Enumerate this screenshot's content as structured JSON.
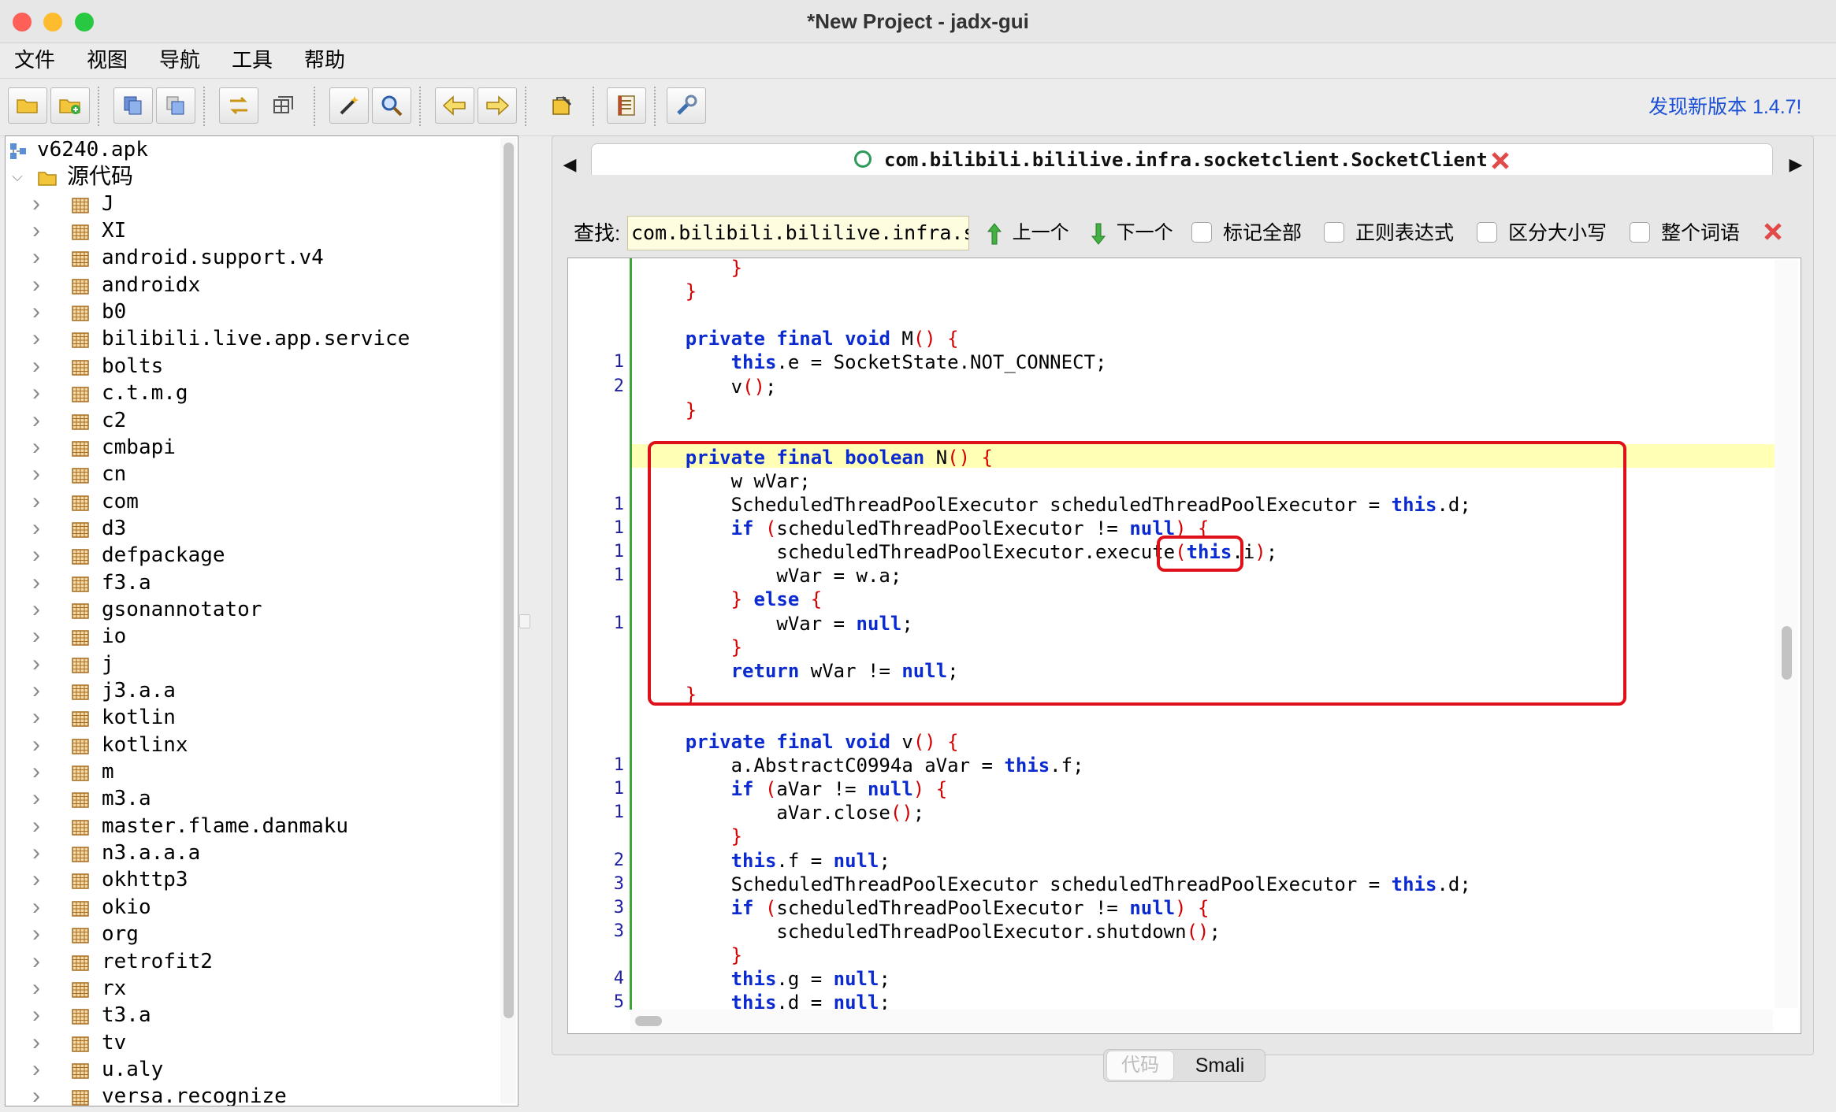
{
  "window": {
    "title": "*New Project - jadx-gui",
    "colors": {
      "close": "#fe5f57",
      "minimize": "#febc2e",
      "zoom": "#28c840"
    }
  },
  "menu": [
    "文件",
    "视图",
    "导航",
    "工具",
    "帮助"
  ],
  "toolbar": {
    "update_link": "发现新版本 1.4.7!",
    "buttons": [
      {
        "name": "open-file-button",
        "icon": "folder-open-icon"
      },
      {
        "name": "add-files-button",
        "icon": "folder-add-icon"
      },
      {
        "name": "save-all-button",
        "icon": "save-all-icon"
      },
      {
        "name": "export-button",
        "icon": "export-icon"
      },
      {
        "name": "sync-tree-button",
        "icon": "sync-icon"
      },
      {
        "name": "flatten-packages-button",
        "icon": "package-icon"
      },
      {
        "name": "decompile-all-button",
        "icon": "magic-wand-icon"
      },
      {
        "name": "search-button",
        "icon": "magnifier-icon"
      },
      {
        "name": "back-button",
        "icon": "arrow-left-icon"
      },
      {
        "name": "forward-button",
        "icon": "arrow-right-icon"
      },
      {
        "name": "deobfuscation-button",
        "icon": "deobfuscation-icon"
      },
      {
        "name": "log-viewer-button",
        "icon": "log-icon"
      },
      {
        "name": "preferences-button",
        "icon": "wrench-icon"
      }
    ]
  },
  "tree": {
    "root": "v6240.apk",
    "source_folder": "源代码",
    "packages": [
      "J",
      "XI",
      "android.support.v4",
      "androidx",
      "b0",
      "bilibili.live.app.service",
      "bolts",
      "c.t.m.g",
      "c2",
      "cmbapi",
      "cn",
      "com",
      "d3",
      "defpackage",
      "f3.a",
      "gsonannotator",
      "io",
      "j",
      "j3.a.a",
      "kotlin",
      "kotlinx",
      "m",
      "m3.a",
      "master.flame.danmaku",
      "n3.a.a.a",
      "okhttp3",
      "okio",
      "org",
      "retrofit2",
      "rx",
      "t3.a",
      "tv",
      "u.aly",
      "versa.recognize"
    ]
  },
  "editor": {
    "tab_title": "com.bilibili.bililive.infra.socketclient.SocketClient",
    "search": {
      "label": "查找:",
      "value": "com.bilibili.bililive.infra.socketclie",
      "prev": "上一个",
      "next": "下一个",
      "options": [
        "标记全部",
        "正则表达式",
        "区分大小写",
        "整个词语"
      ]
    },
    "code_lines": [
      {
        "ln": "",
        "text": "        }"
      },
      {
        "ln": "",
        "text": "    }"
      },
      {
        "ln": "",
        "text": ""
      },
      {
        "ln": "",
        "text": "    private final void M() {"
      },
      {
        "ln": "1",
        "text": "        this.e = SocketState.NOT_CONNECT;"
      },
      {
        "ln": "2",
        "text": "        v();"
      },
      {
        "ln": "",
        "text": "    }"
      },
      {
        "ln": "",
        "text": ""
      },
      {
        "ln": "",
        "text": "    private final boolean N() {"
      },
      {
        "ln": "",
        "text": "        w wVar;"
      },
      {
        "ln": "1",
        "text": "        ScheduledThreadPoolExecutor scheduledThreadPoolExecutor = this.d;"
      },
      {
        "ln": "1",
        "text": "        if (scheduledThreadPoolExecutor != null) {"
      },
      {
        "ln": "1",
        "text": "            scheduledThreadPoolExecutor.execute(this.i);"
      },
      {
        "ln": "1",
        "text": "            wVar = w.a;"
      },
      {
        "ln": "",
        "text": "        } else {"
      },
      {
        "ln": "1",
        "text": "            wVar = null;"
      },
      {
        "ln": "",
        "text": "        }"
      },
      {
        "ln": "",
        "text": "        return wVar != null;"
      },
      {
        "ln": "",
        "text": "    }"
      },
      {
        "ln": "",
        "text": ""
      },
      {
        "ln": "",
        "text": "    private final void v() {"
      },
      {
        "ln": "1",
        "text": "        a.AbstractC0994a aVar = this.f;"
      },
      {
        "ln": "1",
        "text": "        if (aVar != null) {"
      },
      {
        "ln": "1",
        "text": "            aVar.close();"
      },
      {
        "ln": "",
        "text": "        }"
      },
      {
        "ln": "2",
        "text": "        this.f = null;"
      },
      {
        "ln": "3",
        "text": "        ScheduledThreadPoolExecutor scheduledThreadPoolExecutor = this.d;"
      },
      {
        "ln": "3",
        "text": "        if (scheduledThreadPoolExecutor != null) {"
      },
      {
        "ln": "3",
        "text": "            scheduledThreadPoolExecutor.shutdown();"
      },
      {
        "ln": "",
        "text": "        }"
      },
      {
        "ln": "4",
        "text": "        this.g = null;"
      },
      {
        "ln": "5",
        "text": "        this.d = null;"
      }
    ],
    "bottom_tabs": [
      "代码",
      "Smali"
    ]
  }
}
